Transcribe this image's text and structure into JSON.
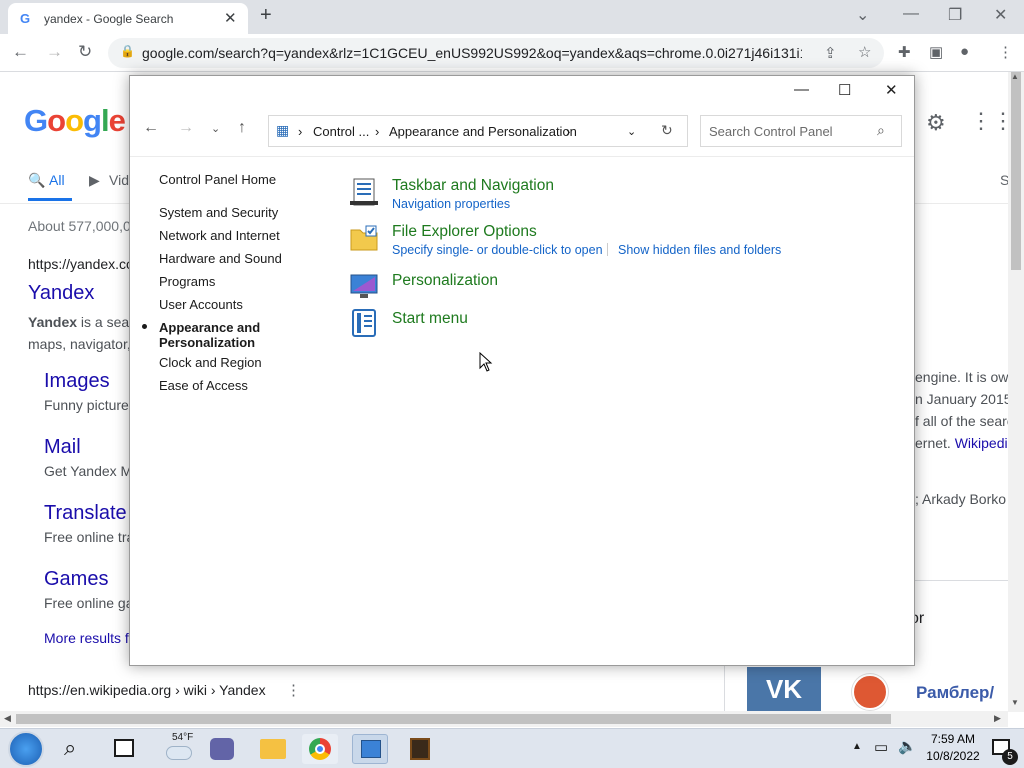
{
  "browser": {
    "tab_title": "yandex - Google Search",
    "tab_favicon": "G",
    "url": "google.com/search?q=yandex&rlz=1C1GCEU_enUS992US992&oq=yandex&aqs=chrome.0.0i271j46i131i19..."
  },
  "google": {
    "logo": "Google",
    "tab_all": "All",
    "tab_video": "Vid",
    "tab_more": "S",
    "stats": "About 577,000,0",
    "result1": {
      "cite": "https://yandex.co",
      "title": "Yandex",
      "snippet_bold": "Yandex",
      "snippet_rest": " is a sea",
      "snippet_line2": "maps, navigator,"
    },
    "sublinks": [
      {
        "title": "Images",
        "desc": "Funny picture"
      },
      {
        "title": "Mail",
        "desc": "Get Yandex M"
      },
      {
        "title": "Translate",
        "desc": "Free online tra"
      },
      {
        "title": "Games",
        "desc": "Free online ga"
      }
    ],
    "more_results": "More results f",
    "result2_cite": "https://en.wikipedia.org › wiki › Yandex",
    "kp_lines": [
      "engine. It is ow",
      "n January 2015",
      "f all of the searc",
      "ernet."
    ],
    "kp_wiki": "Wikipedi",
    "kp_founders": "; Arkady Borko",
    "kp_or": "or",
    "kp_rambler": "Рамблер/"
  },
  "control_panel": {
    "address": {
      "crumb1": "Control ...",
      "crumb2": "Appearance and Personalization"
    },
    "search_placeholder": "Search Control Panel",
    "sidebar": [
      {
        "label": "Control Panel Home"
      },
      {
        "label": "System and Security"
      },
      {
        "label": "Network and Internet"
      },
      {
        "label": "Hardware and Sound"
      },
      {
        "label": "Programs"
      },
      {
        "label": "User Accounts"
      },
      {
        "label": "Appearance and Personalization"
      },
      {
        "label": "Clock and Region"
      },
      {
        "label": "Ease of Access"
      }
    ],
    "active_sidebar_line1": "Appearance and",
    "active_sidebar_line2": "Personalization",
    "categories": [
      {
        "title": "Taskbar and Navigation",
        "links": [
          "Navigation properties"
        ],
        "icon": "taskbar-icon"
      },
      {
        "title": "File Explorer Options",
        "links": [
          "Specify single- or double-click to open",
          "Show hidden files and folders"
        ],
        "icon": "folder-options-icon"
      },
      {
        "title": "Personalization",
        "links": [],
        "icon": "personalization-icon"
      },
      {
        "title": "Start menu",
        "links": [],
        "icon": "start-menu-icon"
      }
    ]
  },
  "taskbar": {
    "weather": "54°F",
    "time": "7:59 AM",
    "date": "10/8/2022",
    "notification_count": "5"
  },
  "colors": {
    "category_title": "#1e7a1e",
    "category_link": "#1464c8",
    "google_link": "#1a0dab"
  }
}
